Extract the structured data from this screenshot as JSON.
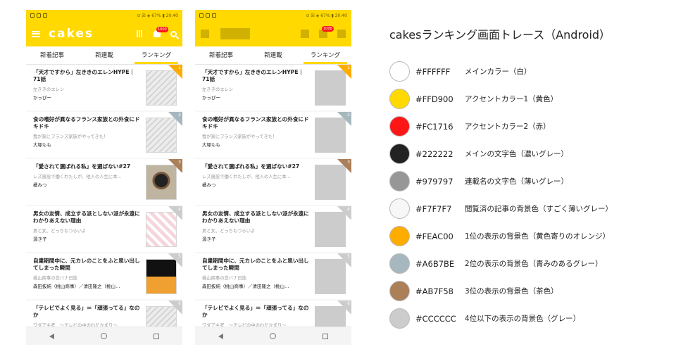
{
  "phones": [
    {
      "status_right": "⊙ ☒ ◈ 67% ▮ 20:40",
      "logo": "cakes",
      "badge": "1000",
      "tabs": [
        "新着記事",
        "新連載",
        "ランキング"
      ],
      "cards": [
        {
          "title": "「天才ですから」左ききのエレンHYPE｜71話",
          "sub": "左ききのエレン",
          "author": "かっぴー",
          "rank": "1"
        },
        {
          "title": "食の嗜好が異なるフランス家族との外食にドキドキ",
          "sub": "我が家にフランス家族がやってきた！",
          "author": "大塚もも",
          "rank": "2"
        },
        {
          "title": "「愛されて選ばれる私」を選ばない#27",
          "sub": "レズ風俗で働くわたしが、他人の人生に本…",
          "author": "橘みつ",
          "rank": "3"
        },
        {
          "title": "男女の友情、成立する派としない派が永遠にわかりあえない理由",
          "sub": "男と女、どっちもつらいよ",
          "author": "湯き子",
          "rank": "4"
        },
        {
          "title": "自粛期間中に、元カレのことをふと思い出してしまった瞬間",
          "sub": "桃山商事の恋バナ日誌",
          "author": "森田抜純（桃山商事）／清田隆之（桃山…",
          "rank": "5"
        },
        {
          "title": "「テレビでよく見る」＝「頑張ってる」なのか",
          "sub": "ワダアキ考　〜テレビの中のわだかまり〜",
          "author": "",
          "rank": "6"
        }
      ]
    },
    {
      "status_right": "⊙ ☒ ◈ 67% ▮ 20:40",
      "badge": "1000",
      "tabs": [
        "新着記事",
        "新連載",
        "ランキング"
      ],
      "cards": [
        {
          "title": "「天才ですから」左ききのエレンHYPE｜71話",
          "sub": "左ききのエレン",
          "author": "かっぴー",
          "rank": "1"
        },
        {
          "title": "食の嗜好が異なるフランス家族との外食にドキドキ",
          "sub": "我が家にフランス家族がやってきた！",
          "author": "大塚もも",
          "rank": "2"
        },
        {
          "title": "「愛されて選ばれる私」を選ばない#27",
          "sub": "レズ風俗で働くわたしが、他人の人生に本…",
          "author": "橘みつ",
          "rank": "3"
        },
        {
          "title": "男女の友情、成立する派としない派が永遠にわかりあえない理由",
          "sub": "男と女、どっちもつらいよ",
          "author": "湯き子",
          "rank": "4"
        },
        {
          "title": "自粛期間中に、元カレのことをふと思い出してしまった瞬間",
          "sub": "桃山商事の恋バナ日誌",
          "author": "森田抜純（桃山商事）／清田隆之（桃山…",
          "rank": "5"
        },
        {
          "title": "「テレビでよく見る」＝「頑張ってる」なのか",
          "sub": "ワダアキ考　〜テレビの中のわだかまり〜",
          "author": "",
          "rank": "6"
        }
      ]
    }
  ],
  "legend": {
    "title": "cakesランキング画面トレース（Android）",
    "colors": [
      {
        "hex": "#FFFFFF",
        "desc": "メインカラー（白）"
      },
      {
        "hex": "#FFD900",
        "desc": "アクセントカラー1（黄色）"
      },
      {
        "hex": "#FC1716",
        "desc": "アクセントカラー2（赤）"
      },
      {
        "hex": "#222222",
        "desc": "メインの文字色（濃いグレー）"
      },
      {
        "hex": "#979797",
        "desc": "連載名の文字色（薄いグレー）"
      },
      {
        "hex": "#F7F7F7",
        "desc": "閲覧済の記事の背景色（すごく薄いグレー）"
      },
      {
        "hex": "#FEAC00",
        "desc": "1位の表示の背景色（黄色寄りのオレンジ）"
      },
      {
        "hex": "#A6B7BE",
        "desc": "2位の表示の背景色（青みのあるグレー）"
      },
      {
        "hex": "#AB7F58",
        "desc": "3位の表示の背景色（茶色）"
      },
      {
        "hex": "#CCCCCC",
        "desc": "4位以下の表示の背景色（グレー）"
      }
    ]
  }
}
